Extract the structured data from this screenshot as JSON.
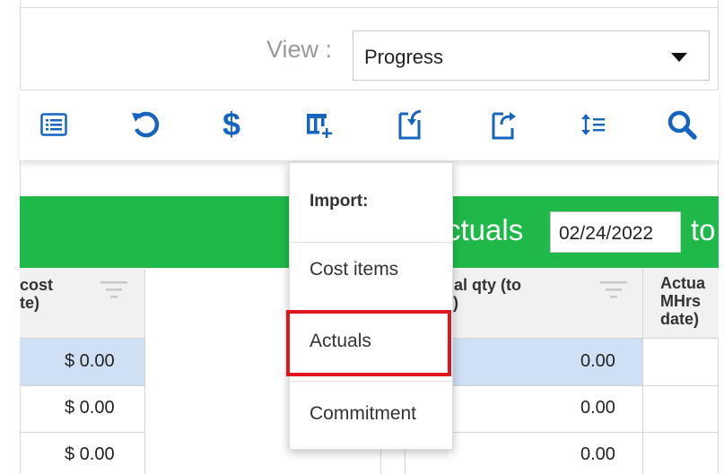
{
  "view": {
    "label": "View :",
    "selected": "Progress"
  },
  "toolbar": {
    "icons": [
      "list-icon",
      "undo-icon",
      "dollar-icon",
      "add-column-icon",
      "import-icon",
      "export-icon",
      "line-spacing-icon",
      "search-icon"
    ],
    "accent": "#1565c0"
  },
  "header_band": {
    "title": "ctuals",
    "date": "02/24/2022",
    "trail": "to",
    "color": "#1fb949"
  },
  "columns": {
    "cost": {
      "line1": "cost",
      "line2": "te)"
    },
    "actual_qty": {
      "line1": "ual qty (to",
      "line2": "e)"
    },
    "actual_mhrs": {
      "line1": "Actua",
      "line2": "MHrs",
      "line3": "date)"
    }
  },
  "rows": [
    {
      "cost": "$ 0.00",
      "qty": "0.00"
    },
    {
      "cost": "$ 0.00",
      "qty": "0.00"
    },
    {
      "cost": "$ 0.00",
      "qty": "0.00"
    }
  ],
  "import_menu": {
    "title": "Import:",
    "items": [
      "Cost items",
      "Actuals",
      "Commitment"
    ],
    "highlighted": "Actuals",
    "highlight_color": "#e0151d"
  },
  "selection_color": "#cfe0f5"
}
